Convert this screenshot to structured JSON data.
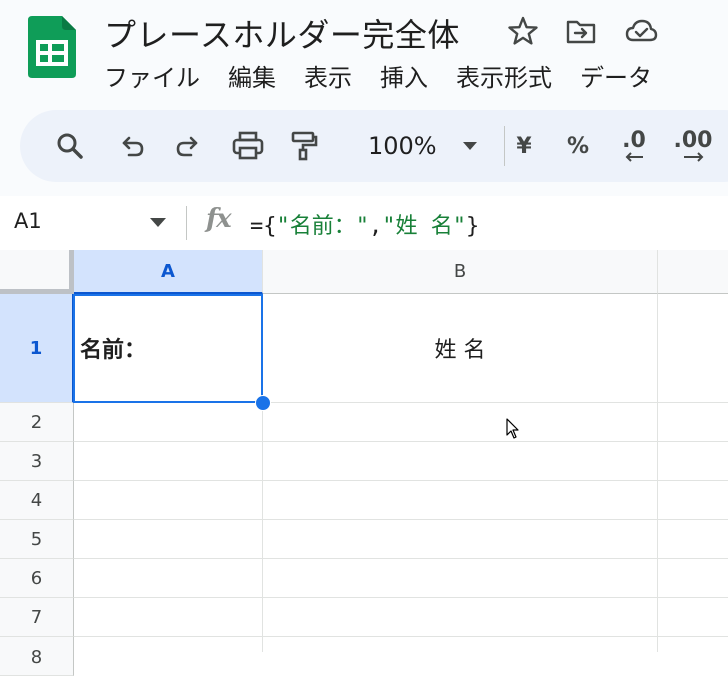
{
  "app": {
    "title": "プレースホルダー完全体",
    "icons": [
      "star-icon",
      "move-to-folder-icon",
      "cloud-saved-icon"
    ],
    "colors": {
      "brand_green": "#0f9d58",
      "selection_blue": "#1a73e8",
      "string_green": "#188038"
    }
  },
  "menu": [
    "ファイル",
    "編集",
    "表示",
    "挿入",
    "表示形式",
    "データ"
  ],
  "toolbar": {
    "icons": [
      "search-icon",
      "undo-icon",
      "redo-icon",
      "print-icon",
      "paint-format-icon"
    ],
    "zoom": "100%",
    "currency": "¥",
    "percent": "%",
    "decrease_decimal": ".0",
    "increase_decimal": ".00"
  },
  "formula_bar": {
    "name_box": "A1",
    "fx": "fx",
    "formula_prefix": "={",
    "string1": "\"名前：\"",
    "comma": ",",
    "string2": "\"姓 名\"",
    "formula_suffix": "}"
  },
  "grid": {
    "columns": [
      "A",
      "B"
    ],
    "rows": [
      "1",
      "2",
      "3",
      "4",
      "5",
      "6",
      "7",
      "8"
    ],
    "cells": {
      "A1": "名前：",
      "B1": "姓 名"
    },
    "selected_cell": "A1"
  }
}
